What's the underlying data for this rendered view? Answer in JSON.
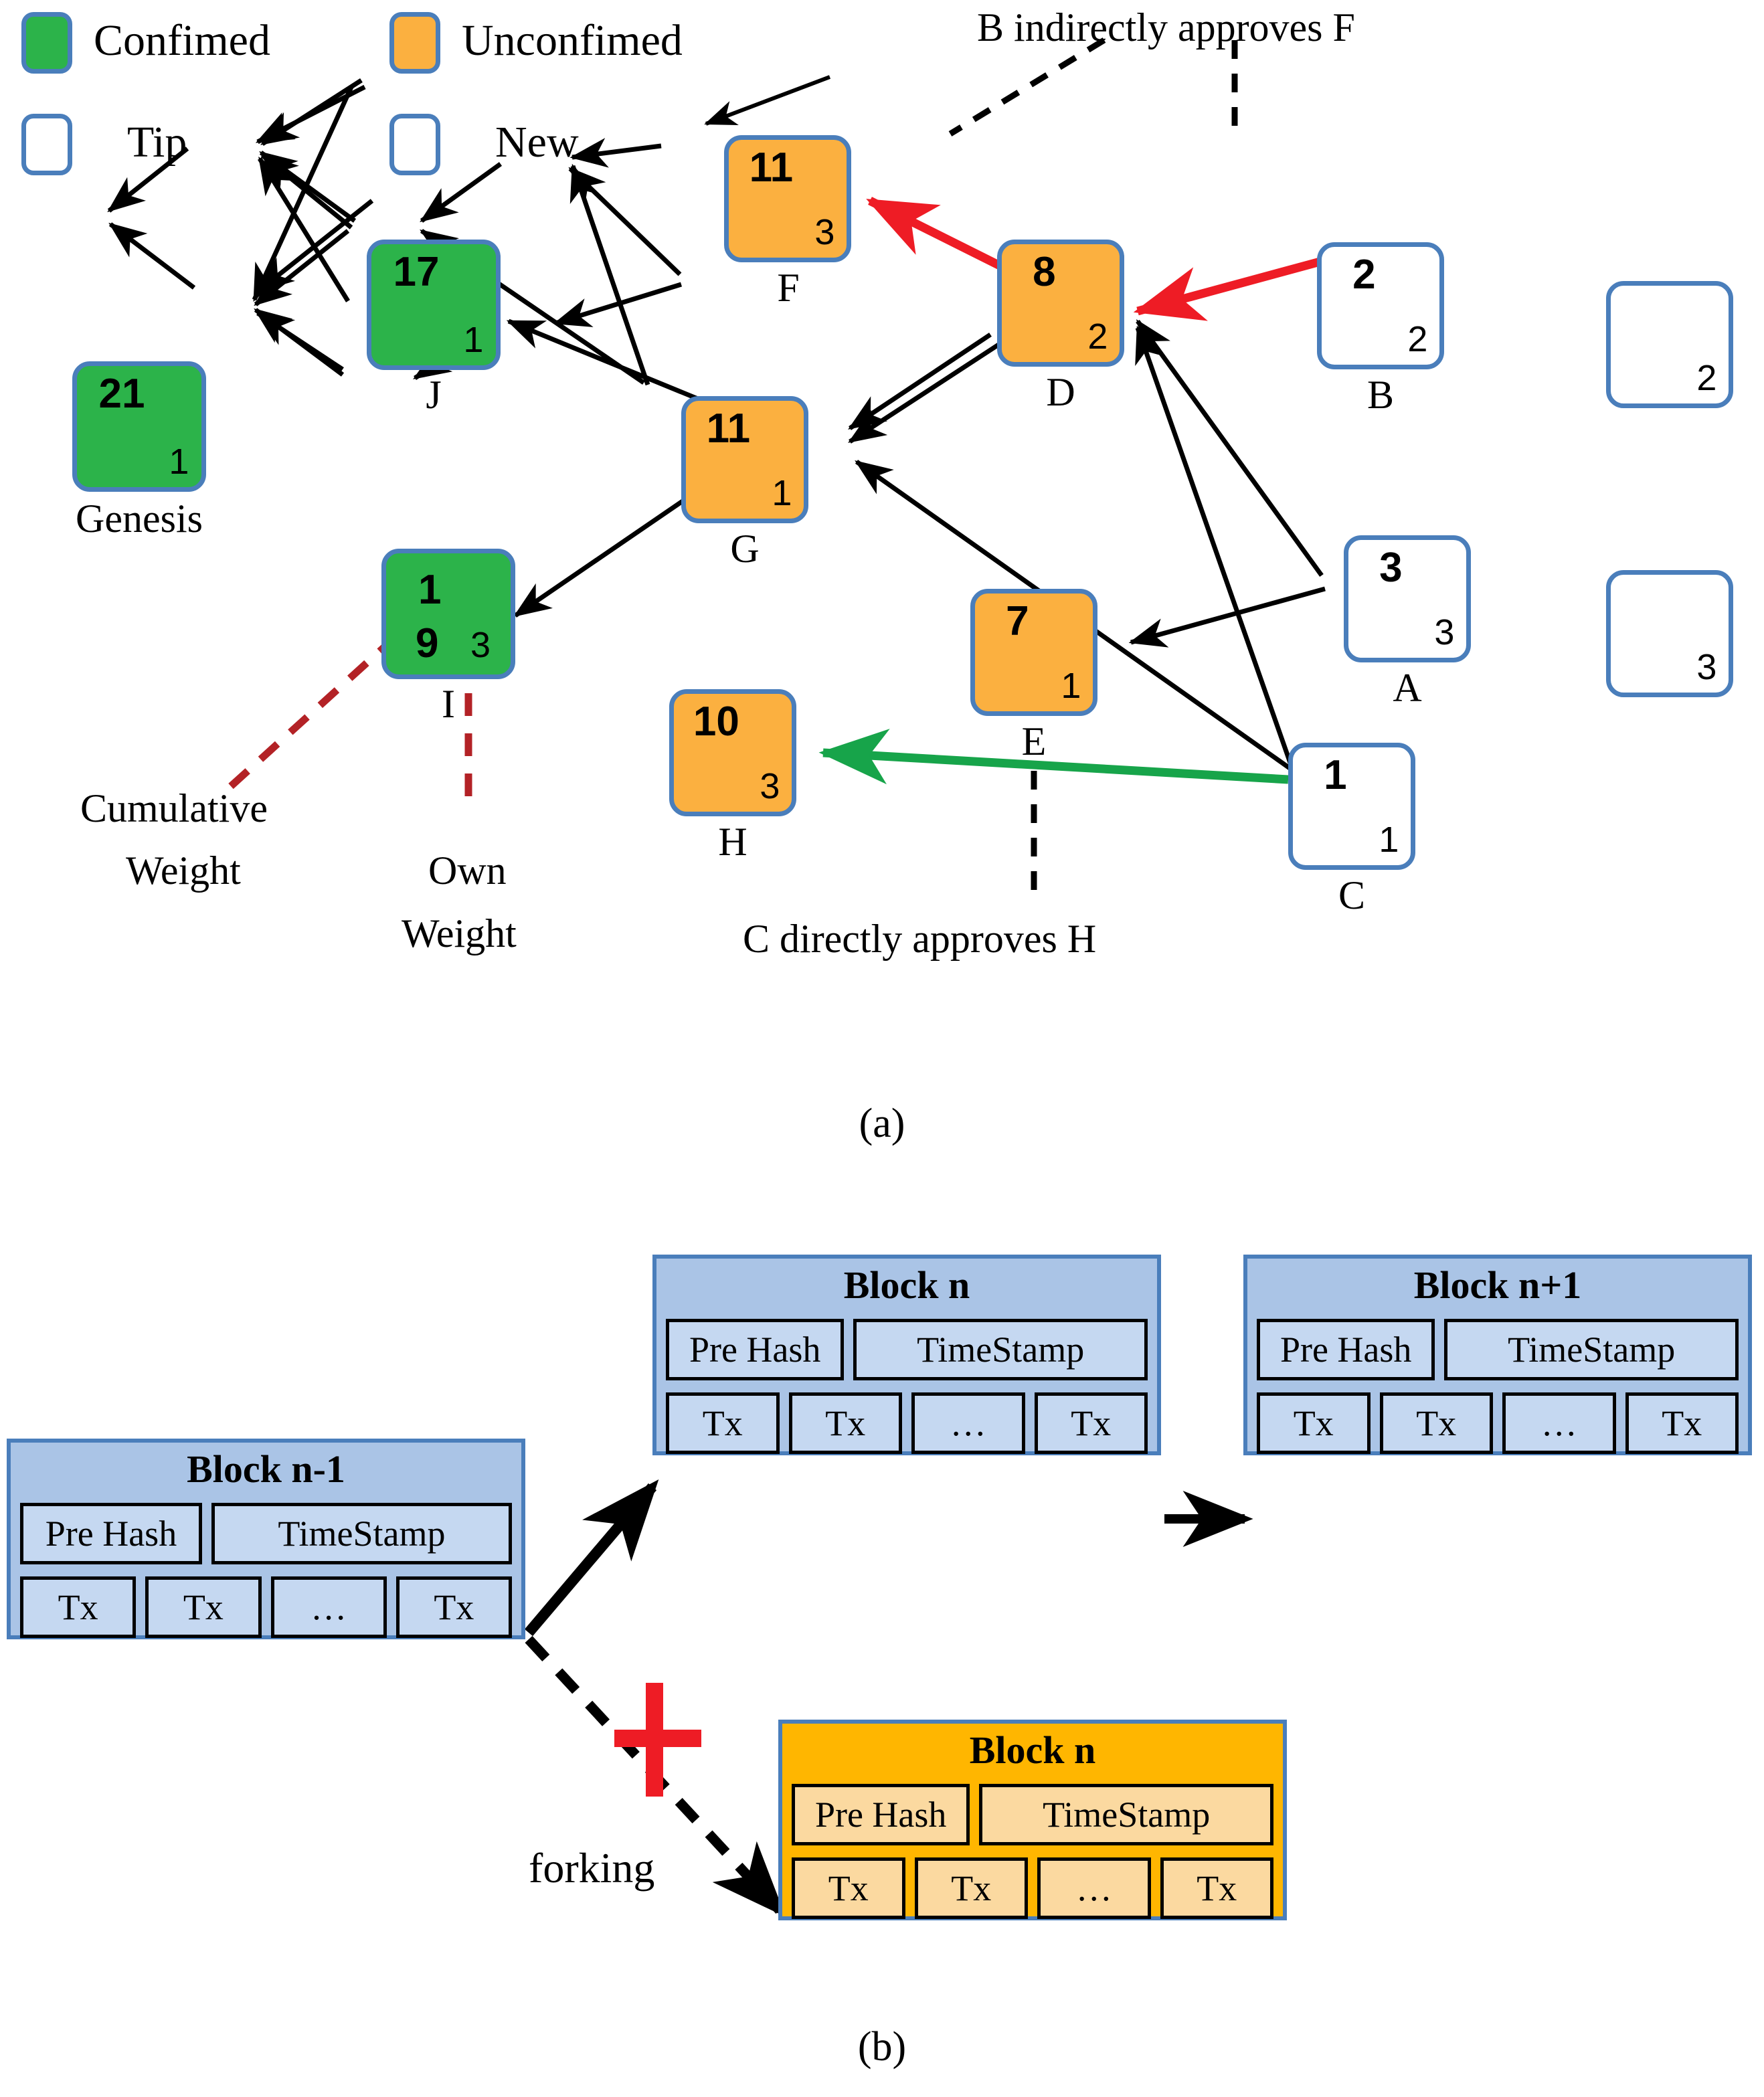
{
  "legend": {
    "items": [
      {
        "key": "confirmed",
        "label": "Confimed",
        "color": "#2cb34a"
      },
      {
        "key": "unconfirmed",
        "label": "Unconfimed",
        "color": "#fbb040"
      },
      {
        "key": "tip",
        "label": "Tip",
        "color": "#ffffff"
      },
      {
        "key": "new",
        "label": "New",
        "color": "#ffffff"
      }
    ]
  },
  "panel_a": {
    "caption": "(a)",
    "nodes": [
      {
        "id": "genesis",
        "name": "Genesis",
        "cumulative_weight": "21",
        "own_weight": "1",
        "state": "confirmed"
      },
      {
        "id": "J",
        "name": "J",
        "cumulative_weight": "17",
        "own_weight": "1",
        "state": "confirmed"
      },
      {
        "id": "I",
        "name": "I",
        "cumulative_weight": "19",
        "cw_first_digit": "1",
        "cw_rest": "9",
        "own_weight": "3",
        "state": "confirmed"
      },
      {
        "id": "F",
        "name": "F",
        "cumulative_weight": "11",
        "own_weight": "3",
        "state": "unconfirmed"
      },
      {
        "id": "G",
        "name": "G",
        "cumulative_weight": "11",
        "own_weight": "1",
        "state": "unconfirmed"
      },
      {
        "id": "H",
        "name": "H",
        "cumulative_weight": "10",
        "own_weight": "3",
        "state": "unconfirmed"
      },
      {
        "id": "D",
        "name": "D",
        "cumulative_weight": "8",
        "own_weight": "2",
        "state": "unconfirmed"
      },
      {
        "id": "E",
        "name": "E",
        "cumulative_weight": "7",
        "own_weight": "1",
        "state": "unconfirmed"
      },
      {
        "id": "B",
        "name": "B",
        "cumulative_weight": "2",
        "own_weight": "2",
        "state": "tip"
      },
      {
        "id": "A",
        "name": "A",
        "cumulative_weight": "3",
        "own_weight": "3",
        "state": "tip"
      },
      {
        "id": "C",
        "name": "C",
        "cumulative_weight": "1",
        "own_weight": "1",
        "state": "tip"
      },
      {
        "id": "new1",
        "name": "",
        "cumulative_weight": "",
        "own_weight": "2",
        "state": "new"
      },
      {
        "id": "new2",
        "name": "",
        "cumulative_weight": "",
        "own_weight": "3",
        "state": "new"
      }
    ],
    "annotations": {
      "indirect": "B indirectly approves  F",
      "direct": "C directly approves  H",
      "cumulative_weight_l1": "Cumulative",
      "cumulative_weight_l2": "Weight",
      "own_weight_l1": "Own",
      "own_weight_l2": "Weight"
    },
    "colors": {
      "confirmed": "#2cb34a",
      "unconfirmed": "#fbb040",
      "node_border": "#4a7ebb",
      "indirect_edge": "#ee1c25",
      "direct_edge": "#17a44a",
      "highlight_circle": "#ee1c25",
      "callout_line": "#b32226"
    }
  },
  "panel_b": {
    "caption": "(b)",
    "forking_label": "forking",
    "header_fields": [
      "Pre Hash",
      "TimeStamp"
    ],
    "tx_fields": [
      "Tx",
      "Tx",
      "…",
      "Tx"
    ],
    "blocks": [
      {
        "id": "prev",
        "title": "Block n-1",
        "variant": "main"
      },
      {
        "id": "n",
        "title": "Block n",
        "variant": "main"
      },
      {
        "id": "n1",
        "title": "Block n+1",
        "variant": "main"
      },
      {
        "id": "fork",
        "title": "Block n",
        "variant": "fork"
      }
    ],
    "colors": {
      "block_fill": "#aac4e6",
      "block_cell": "#c5d8f1",
      "fork_fill": "#ffb600",
      "fork_cell": "#fbd9a0",
      "block_border": "#4a7ebb",
      "cross": "#ee1c25"
    }
  }
}
